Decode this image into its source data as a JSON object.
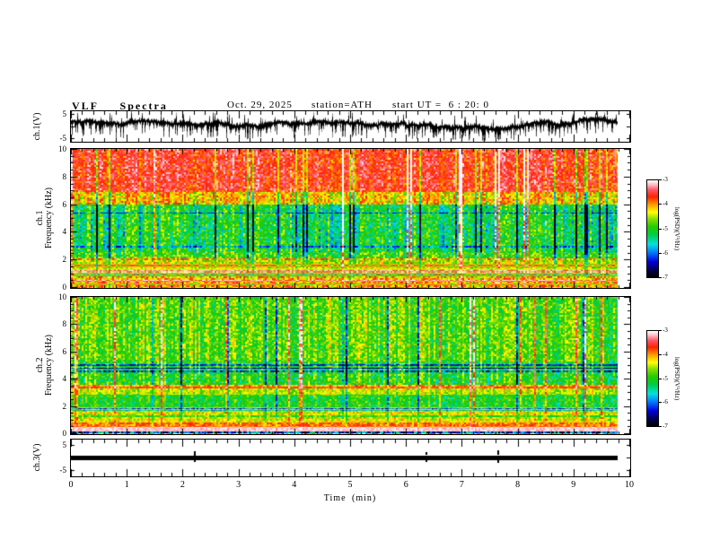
{
  "header": {
    "title": "VLF  Spectra",
    "date": "Oct. 29, 2025",
    "station": "station=ATH",
    "start_ut": "start UT =  6 : 20: 0"
  },
  "x_axis": {
    "label": "Time  (min)",
    "min": 0,
    "max": 10,
    "major": 1,
    "minor": 0.2,
    "data_end": 9.78
  },
  "colormap": {
    "label": "log(PSD)(V²/Hz)",
    "ticks": [
      "-3",
      "-4",
      "-5",
      "-6",
      "-7"
    ],
    "vmin": -7,
    "vmax": -3,
    "stops": [
      {
        "t": 0.0,
        "c": "#000000"
      },
      {
        "t": 0.07,
        "c": "#00004a"
      },
      {
        "t": 0.16,
        "c": "#0000dd"
      },
      {
        "t": 0.26,
        "c": "#0080ff"
      },
      {
        "t": 0.34,
        "c": "#00e0e0"
      },
      {
        "t": 0.44,
        "c": "#00cc44"
      },
      {
        "t": 0.52,
        "c": "#22cc00"
      },
      {
        "t": 0.6,
        "c": "#88dd00"
      },
      {
        "t": 0.67,
        "c": "#ffff00"
      },
      {
        "t": 0.75,
        "c": "#ff9900"
      },
      {
        "t": 0.83,
        "c": "#ff2200"
      },
      {
        "t": 0.9,
        "c": "#ff5566"
      },
      {
        "t": 0.96,
        "c": "#ffc4cc"
      },
      {
        "t": 1.0,
        "c": "#ffffff"
      }
    ]
  },
  "chart_data": {
    "type": "heatmap",
    "title": "VLF Spectra, Oct. 29 2025, station ATH, start UT 6:20:0, 0-10 min, two spectrogram channels 0-10 kHz with PSD colorbars -7..-3 log(V2/Hz), plus ch.1 and ch.3 voltage waveforms",
    "panels": [
      {
        "name": "ch1_waveform",
        "kind": "waveform",
        "ylabel": "ch.1(V)",
        "ylim": [
          -6,
          6
        ],
        "yticks": [
          -5,
          0,
          5
        ],
        "ylabels": [
          5,
          -5
        ],
        "seed": 42,
        "baseline": 0.9,
        "neg_spike_rate": 0.32,
        "pos_spike_rate": 0.1,
        "summary": "noisy black trace around +1 V with dense impulsive spikes down to -5 V across 0-9.78 min"
      },
      {
        "name": "ch1_spectrogram",
        "kind": "spectrogram",
        "ylabel_lines": [
          "ch.1",
          "Frequency (kHz)"
        ],
        "ylim": [
          0,
          10
        ],
        "ymajor": 2,
        "yminor": 0.5,
        "seed": 7,
        "bands": [
          {
            "f": [
              6.9,
              10.0
            ],
            "v": -3.65,
            "noise": 0.35,
            "streak": 0.55
          },
          {
            "f": [
              6.0,
              6.9
            ],
            "v": -4.25,
            "noise": 0.45,
            "streak": 0.8
          },
          {
            "f": [
              2.6,
              6.0
            ],
            "v": -5.25,
            "noise": 0.5,
            "streak": 1.1
          },
          {
            "f": [
              2.0,
              2.6
            ],
            "v": -4.95,
            "noise": 0.55,
            "streak": 0.7
          },
          {
            "f": [
              1.45,
              2.0
            ],
            "v": -4.55,
            "noise": 0.45,
            "streak": 0.45
          },
          {
            "f": [
              1.0,
              1.45
            ],
            "v": -3.3,
            "noise": 0.25,
            "streak": 0.15
          },
          {
            "f": [
              0.6,
              1.0
            ],
            "v": -4.1,
            "noise": 0.5,
            "streak": 0.3
          },
          {
            "f": [
              0.0,
              0.6
            ],
            "v": -4.0,
            "noise": 0.6,
            "streak": 0.3
          }
        ],
        "lines": [
          {
            "f": 5.38,
            "dv": -0.9,
            "w": 0.05
          },
          {
            "f": 2.98,
            "dv": -0.7,
            "w": 0.05
          },
          {
            "f": 2.04,
            "dv": 0.9,
            "w": 0.06
          },
          {
            "f": 1.62,
            "dv": 0.7,
            "w": 0.05
          },
          {
            "f": 1.34,
            "dv": -1.1,
            "w": 0.05
          },
          {
            "f": 1.18,
            "dv": -1.3,
            "w": 0.05
          },
          {
            "f": 1.04,
            "dv": -1.2,
            "w": 0.05
          },
          {
            "f": 0.88,
            "dv": -0.9,
            "w": 0.05
          },
          {
            "f": 0.55,
            "dv": 0.8,
            "w": 0.05
          },
          {
            "f": 0.3,
            "dv": -0.6,
            "w": 0.05
          }
        ],
        "summary": "red saturated band above ~7 kHz, green/cyan mid band 2.5-6 kHz with vertical sferic streaks and dark dropouts, whitish band near 1-1.4 kHz, red/yellow striping below 1 kHz"
      },
      {
        "name": "ch2_spectrogram",
        "kind": "spectrogram",
        "ylabel_lines": [
          "ch.2",
          "Frequency (kHz)"
        ],
        "ylim": [
          0,
          10
        ],
        "ymajor": 2,
        "yminor": 0.5,
        "seed": 99,
        "bands": [
          {
            "f": [
              5.3,
              10.0
            ],
            "v": -4.8,
            "noise": 0.45,
            "streak": 0.8
          },
          {
            "f": [
              3.6,
              5.3
            ],
            "v": -5.0,
            "noise": 0.45,
            "streak": 0.85
          },
          {
            "f": [
              3.35,
              3.6
            ],
            "v": -4.05,
            "noise": 0.35,
            "streak": 0.3
          },
          {
            "f": [
              2.85,
              3.35
            ],
            "v": -4.5,
            "noise": 0.35,
            "streak": 0.45
          },
          {
            "f": [
              1.95,
              2.85
            ],
            "v": -5.05,
            "noise": 0.4,
            "streak": 0.55
          },
          {
            "f": [
              1.0,
              1.95
            ],
            "v": -4.4,
            "noise": 0.4,
            "streak": 0.35
          },
          {
            "f": [
              0.55,
              1.0
            ],
            "v": -3.9,
            "noise": 0.35,
            "streak": 0.2
          },
          {
            "f": [
              0.22,
              0.55
            ],
            "v": -3.15,
            "noise": 0.12,
            "streak": 0.05
          },
          {
            "f": [
              0.0,
              0.22
            ],
            "v": -3.9,
            "noise": 0.9,
            "streak": 0.1
          }
        ],
        "lines": [
          {
            "f": 5.02,
            "dv": -1.2,
            "w": 0.05
          },
          {
            "f": 4.8,
            "dv": -1.5,
            "w": 0.05
          },
          {
            "f": 4.57,
            "dv": -1.0,
            "w": 0.05
          },
          {
            "f": 3.42,
            "dv": 0.45,
            "w": 0.06
          },
          {
            "f": 1.87,
            "dv": -1.6,
            "w": 0.05
          },
          {
            "f": 1.74,
            "dv": -1.2,
            "w": 0.05
          },
          {
            "f": 1.3,
            "dv": -0.5,
            "w": 0.05
          },
          {
            "f": 0.92,
            "dv": -0.4,
            "w": 0.05
          },
          {
            "f": 0.13,
            "dv": -2.2,
            "w": 0.05
          }
        ],
        "summary": "green/yellow field with vertical streaks, dark horizontal lines near 4.6-5.0 and 1.8 kHz, red band 3.4 kHz, red band 0.5-1 kHz, white band 0.2-0.5 kHz"
      },
      {
        "name": "ch3_waveform",
        "kind": "flatline",
        "ylabel": "ch.3(V)",
        "ylim": [
          -7,
          7
        ],
        "yticks": [
          -5,
          0,
          5
        ],
        "ylabels": [
          5,
          -5
        ],
        "value": 0,
        "thickness_v": 0.8,
        "spikes": [
          {
            "t": 2.2,
            "amp": 1.6
          },
          {
            "t": 6.35,
            "amp": 1.1
          },
          {
            "t": 7.63,
            "amp": 1.8
          }
        ],
        "summary": "flat thick black trace at 0 V with a few tiny spikes"
      }
    ]
  }
}
